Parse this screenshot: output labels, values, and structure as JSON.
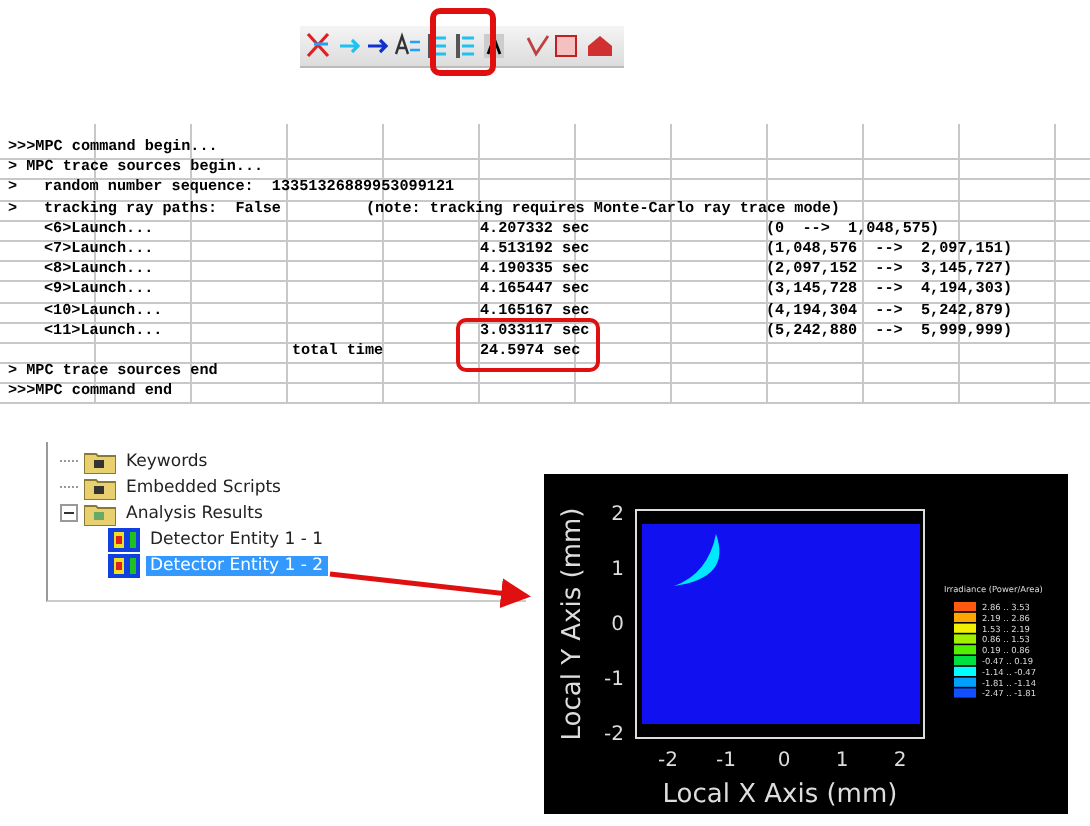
{
  "console": {
    "rows": [
      {
        "kind": "header",
        "text": ">>>MPC command begin..."
      },
      {
        "kind": "header",
        "text": "> MPC trace sources begin..."
      },
      {
        "kind": "entry",
        "prompt": ">",
        "text": "random number sequence:  13351326889953099121"
      },
      {
        "kind": "entry",
        "prompt": ">",
        "text": "tracking ray paths:  False",
        "note": "(note: tracking requires Monte-Carlo ray trace mode)"
      },
      {
        "kind": "entry",
        "text": "<6>Launch...",
        "time": "4.207332 sec",
        "range": "(0  -->  1,048,575)"
      },
      {
        "kind": "entry",
        "text": "<7>Launch...",
        "time": "4.513192 sec",
        "range": "(1,048,576  -->  2,097,151)"
      },
      {
        "kind": "entry",
        "text": "<8>Launch...",
        "time": "4.190335 sec",
        "range": "(2,097,152  -->  3,145,727)"
      },
      {
        "kind": "entry",
        "text": "<9>Launch...",
        "time": "4.165447 sec",
        "range": "(3,145,728  -->  4,194,303)"
      },
      {
        "kind": "entry",
        "text": "<10>Launch...",
        "time": "4.165167 sec",
        "range": "(4,194,304  -->  5,242,879)"
      },
      {
        "kind": "entry",
        "text": "<11>Launch...",
        "time": "3.033117 sec",
        "range": "(5,242,880  -->  5,999,999)"
      },
      {
        "kind": "entry",
        "label": "total time",
        "time": "24.5974 sec"
      },
      {
        "kind": "header",
        "text": "> MPC trace sources end"
      },
      {
        "kind": "header",
        "text": ">>>MPC command end"
      }
    ]
  },
  "tree": {
    "items": [
      {
        "label": "Keywords",
        "expanded": false,
        "selected": false
      },
      {
        "label": "Embedded Scripts",
        "expanded": false,
        "selected": false
      },
      {
        "label": "Analysis Results",
        "expanded": true,
        "selected": false,
        "children": [
          {
            "label": "Detector Entity 1 - 1",
            "selected": false
          },
          {
            "label": "Detector Entity 1 - 2",
            "selected": true
          }
        ]
      }
    ]
  },
  "plot": {
    "xlabel": "Local X Axis (mm)",
    "ylabel": "Local Y Axis (mm)",
    "xticks": [
      "-2",
      "-1",
      "0",
      "1",
      "2"
    ],
    "yticks": [
      "2",
      "1",
      "0",
      "-1",
      "-2"
    ],
    "legend": {
      "title": "Irradiance (Power/Area)",
      "entries": [
        {
          "label": "2.86 .. 3.53",
          "color": "#ff5a10"
        },
        {
          "label": "2.19 .. 2.86",
          "color": "#ffa500"
        },
        {
          "label": "1.53 .. 2.19",
          "color": "#f0f000"
        },
        {
          "label": "0.86 .. 1.53",
          "color": "#a0f000"
        },
        {
          "label": "0.19 .. 0.86",
          "color": "#50f000"
        },
        {
          "label": "-0.47 .. 0.19",
          "color": "#00e040"
        },
        {
          "label": "-1.14 .. -0.47",
          "color": "#00ffff"
        },
        {
          "label": "-1.81 .. -1.14",
          "color": "#00a0ff"
        },
        {
          "label": "-2.47 .. -1.81",
          "color": "#1050ff"
        }
      ]
    }
  }
}
